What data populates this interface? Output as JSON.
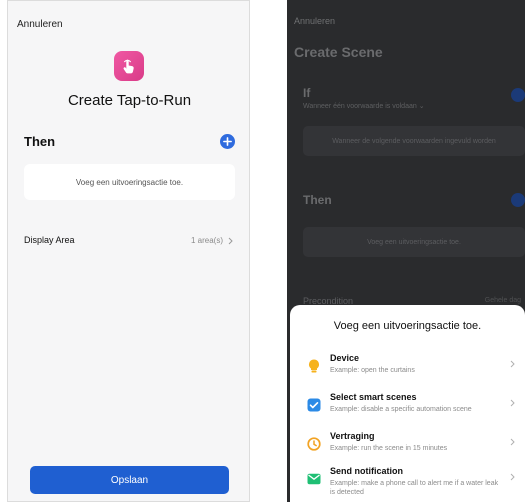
{
  "left": {
    "cancel": "Annuleren",
    "title": "Create Tap-to-Run",
    "then_label": "Then",
    "action_placeholder": "Voeg een uitvoeringsactie toe.",
    "display_area_label": "Display Area",
    "display_area_value": "1 area(s)",
    "save_label": "Opslaan",
    "icon": "tap-hand-icon"
  },
  "right": {
    "cancel": "Annuleren",
    "title": "Create Scene",
    "if_label": "If",
    "condition_trigger": "Wanneer één voorwaarde is voldaan",
    "condition_placeholder": "Wanneer de volgende voorwaarden ingevuld worden",
    "then_label": "Then",
    "action_placeholder": "Voeg een uitvoeringsactie toe.",
    "precondition_label": "Precondition",
    "precondition_value": "Gehele dag",
    "sheet": {
      "title": "Voeg een uitvoeringsactie toe.",
      "options": [
        {
          "name": "Device",
          "example": "Example: open the curtains",
          "icon": "lightbulb-icon"
        },
        {
          "name": "Select smart scenes",
          "example": "Example: disable a specific automation scene",
          "icon": "checkbox-icon"
        },
        {
          "name": "Vertraging",
          "example": "Example: run the scene in 15 minutes",
          "icon": "clock-icon"
        },
        {
          "name": "Send notification",
          "example": "Example: make a phone call to alert me if a water leak is detected",
          "icon": "mail-icon"
        }
      ]
    }
  },
  "colors": {
    "accent": "#1f5fd1",
    "app_icon": "#e14593"
  }
}
